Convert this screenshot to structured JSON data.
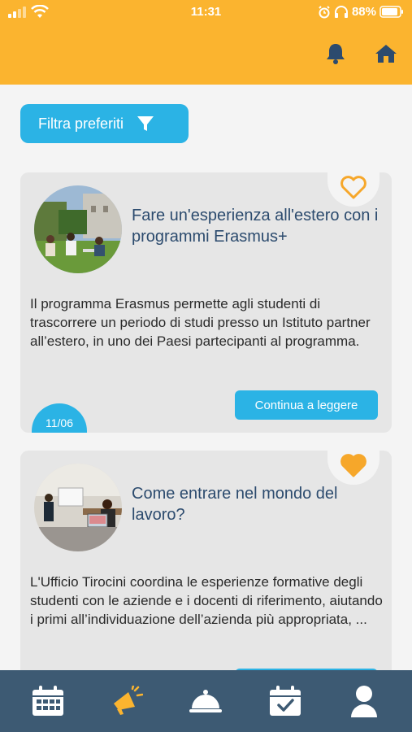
{
  "status_bar": {
    "time": "11:31",
    "battery": "88%"
  },
  "header": {
    "icons": [
      "bell-icon",
      "home-icon"
    ]
  },
  "filter": {
    "label": "Filtra preferiti",
    "icon": "filter-icon"
  },
  "cards": [
    {
      "title": "Fare un'esperienza all'estero con i programmi Erasmus+",
      "text": "Il programma Erasmus permette agli studenti di trascorrere un periodo di studi presso un Istituto partner all’estero, in uno dei Paesi partecipanti al programma.",
      "read_more": "Continua a leggere",
      "date": "11/06",
      "favorite": false
    },
    {
      "title": "Come entrare nel mondo del lavoro?",
      "text": "L'Ufficio Tirocini coordina le esperienze formative degli studenti con le aziende e i docenti di riferimento, aiutando i primi all’individuazione dell’azienda più appropriata, ...",
      "read_more": "",
      "favorite": true
    }
  ],
  "bottom_nav": {
    "items": [
      "calendar-icon",
      "megaphone-icon",
      "cloche-icon",
      "calendar-check-icon",
      "user-icon"
    ],
    "active": "megaphone-icon"
  },
  "colors": {
    "header": "#fbb42f",
    "accent": "#2bb3e5",
    "nav": "#3d5a73",
    "heart": "#f6a72a"
  }
}
